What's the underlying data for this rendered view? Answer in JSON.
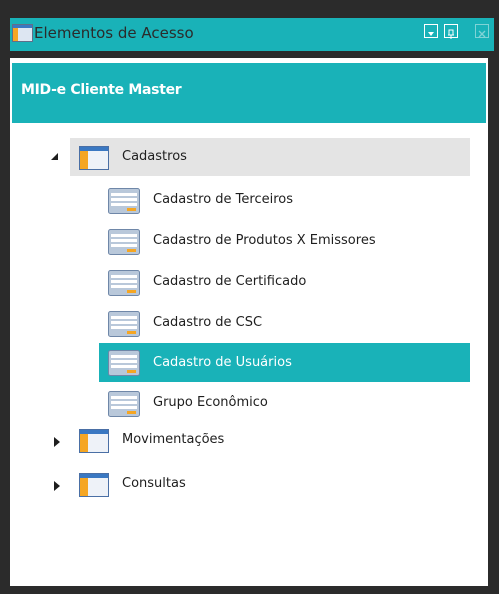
{
  "window": {
    "title": "Elementos de Acesso",
    "buttons": [
      "dropdown-icon",
      "pin-icon",
      "close-icon"
    ]
  },
  "header": {
    "title": "MID-e Cliente Master"
  },
  "tree": {
    "groups": [
      {
        "label": "Cadastros",
        "expanded": true,
        "items": [
          {
            "label": "Cadastro de Terceiros",
            "selected": false
          },
          {
            "label": "Cadastro de Produtos X Emissores",
            "selected": false
          },
          {
            "label": "Cadastro de Certificado",
            "selected": false
          },
          {
            "label": "Cadastro de CSC",
            "selected": false
          },
          {
            "label": "Cadastro de Usuários",
            "selected": true
          },
          {
            "label": "Grupo Econômico",
            "selected": false
          }
        ]
      },
      {
        "label": "Movimentações",
        "expanded": false,
        "items": []
      },
      {
        "label": "Consultas",
        "expanded": false,
        "items": []
      }
    ]
  },
  "colors": {
    "accent": "#19b2b8",
    "frame": "#2b2b2b",
    "group_highlight": "#e4e4e4"
  }
}
